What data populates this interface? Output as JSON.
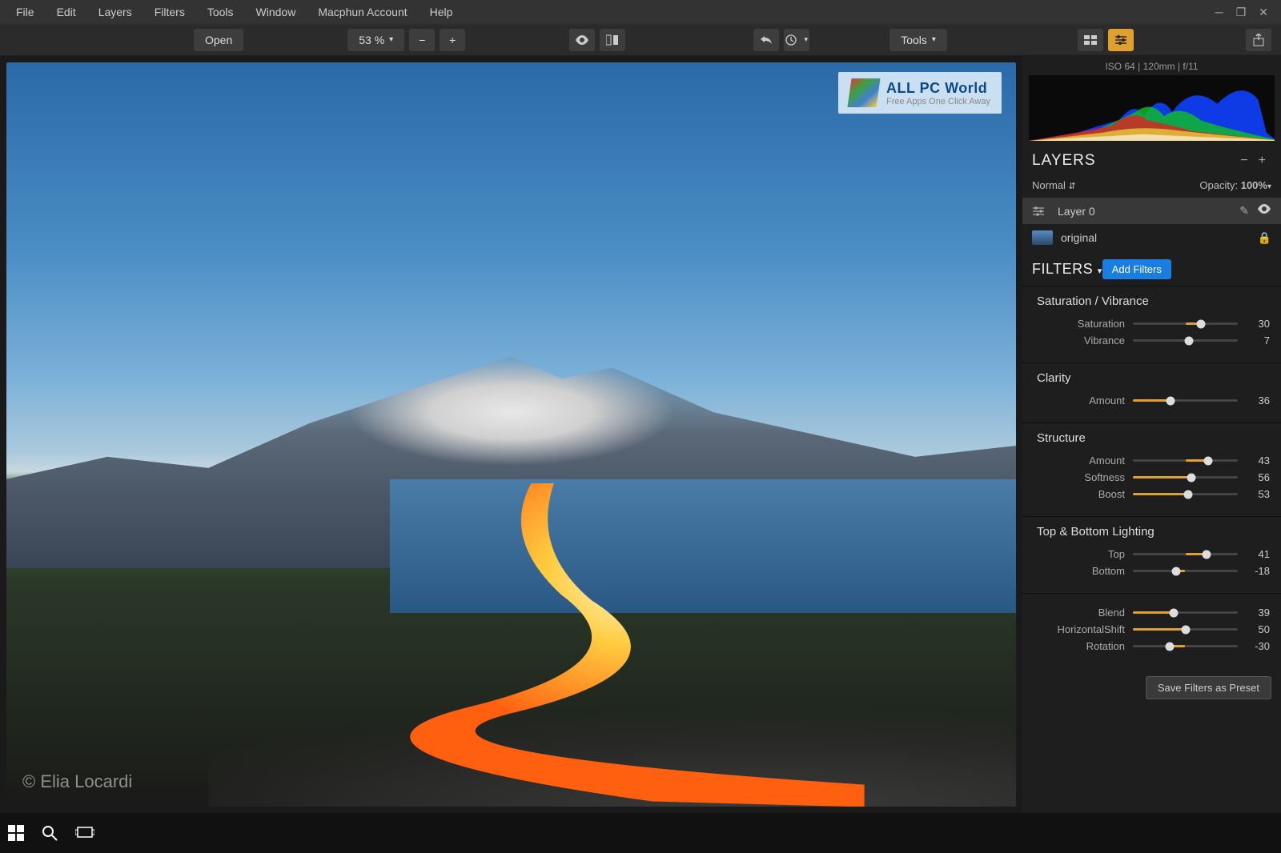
{
  "menu": {
    "items": [
      "File",
      "Edit",
      "Layers",
      "Filters",
      "Tools",
      "Window",
      "Macphun Account",
      "Help"
    ]
  },
  "toolbar": {
    "open": "Open",
    "zoom": "53 %",
    "tools": "Tools"
  },
  "photo": {
    "credit": "© Elia Locardi",
    "watermark_title": "ALL PC World",
    "watermark_sub": "Free Apps One Click Away"
  },
  "meta": "ISO 64  |  120mm  |  f/11",
  "layers": {
    "title": "LAYERS",
    "blend_mode": "Normal",
    "opacity_label": "Opacity:",
    "opacity_value": "100%",
    "items": [
      {
        "name": "Layer 0",
        "type": "adjust",
        "active": true
      },
      {
        "name": "original",
        "type": "image",
        "active": false,
        "locked": true
      }
    ]
  },
  "filters": {
    "title": "FILTERS",
    "add_label": "Add Filters",
    "save_preset": "Save Filters as Preset",
    "groups": [
      {
        "name": "Saturation / Vibrance",
        "sliders": [
          {
            "label": "Saturation",
            "value": 30,
            "min": -100,
            "max": 100
          },
          {
            "label": "Vibrance",
            "value": 7,
            "min": -100,
            "max": 100
          }
        ]
      },
      {
        "name": "Clarity",
        "sliders": [
          {
            "label": "Amount",
            "value": 36,
            "min": 0,
            "max": 100
          }
        ]
      },
      {
        "name": "Structure",
        "sliders": [
          {
            "label": "Amount",
            "value": 43,
            "min": -100,
            "max": 100
          },
          {
            "label": "Softness",
            "value": 56,
            "min": 0,
            "max": 100
          },
          {
            "label": "Boost",
            "value": 53,
            "min": 0,
            "max": 100
          }
        ]
      },
      {
        "name": "Top & Bottom Lighting",
        "sliders": [
          {
            "label": "Top",
            "value": 41,
            "min": -100,
            "max": 100
          },
          {
            "label": "Bottom",
            "value": -18,
            "min": -100,
            "max": 100
          }
        ]
      },
      {
        "name": "",
        "sliders": [
          {
            "label": "Blend",
            "value": 39,
            "min": 0,
            "max": 100
          },
          {
            "label": "HorizontalShift",
            "value": 50,
            "min": 0,
            "max": 100
          },
          {
            "label": "Rotation",
            "value": -30,
            "min": -100,
            "max": 100
          }
        ]
      }
    ]
  }
}
